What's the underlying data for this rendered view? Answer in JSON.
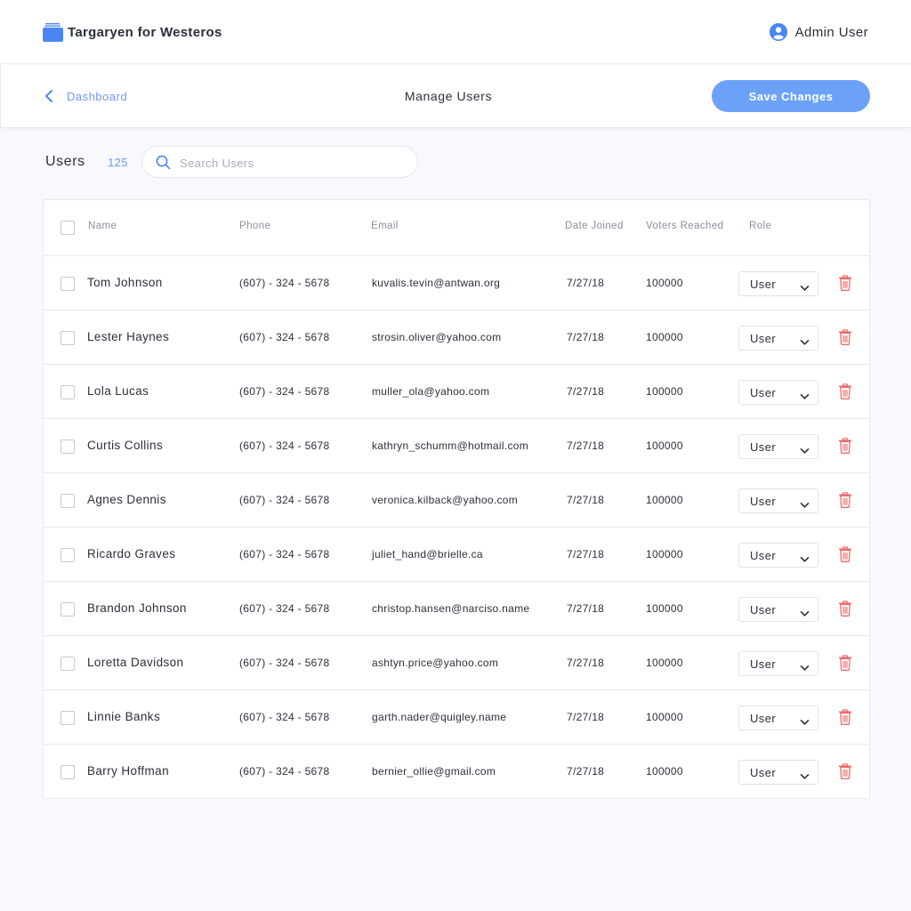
{
  "header": {
    "app_name": "Targaryen for Westeros",
    "user_name": "Admin User"
  },
  "subheader": {
    "back_label": "Dashboard",
    "title": "Manage Users",
    "save_label": "Save Changes"
  },
  "users_section": {
    "heading": "Users",
    "count": "125",
    "search_placeholder": "Search Users",
    "search_value": ""
  },
  "table": {
    "columns": {
      "name": "Name",
      "phone": "Phone",
      "email": "Email",
      "date_joined": "Date Joined",
      "voters_reached": "Voters Reached",
      "role": "Role"
    },
    "rows": [
      {
        "name": "Tom Johnson",
        "phone": "(607) - 324 - 5678",
        "email": "kuvalis.tevin@antwan.org",
        "date": "7/27/18",
        "voters": "100000",
        "role": "User"
      },
      {
        "name": "Lester Haynes",
        "phone": "(607) - 324 - 5678",
        "email": "strosin.oliver@yahoo.com",
        "date": "7/27/18",
        "voters": "100000",
        "role": "User"
      },
      {
        "name": "Lola Lucas",
        "phone": "(607) - 324 - 5678",
        "email": "muller_ola@yahoo.com",
        "date": "7/27/18",
        "voters": "100000",
        "role": "User"
      },
      {
        "name": "Curtis Collins",
        "phone": "(607) - 324 - 5678",
        "email": "kathryn_schumm@hotmail.com",
        "date": "7/27/18",
        "voters": "100000",
        "role": "User"
      },
      {
        "name": "Agnes Dennis",
        "phone": "(607) - 324 - 5678",
        "email": "veronica.kilback@yahoo.com",
        "date": "7/27/18",
        "voters": "100000",
        "role": "User"
      },
      {
        "name": "Ricardo Graves",
        "phone": "(607) - 324 - 5678",
        "email": "juliet_hand@brielle.ca",
        "date": "7/27/18",
        "voters": "100000",
        "role": "User"
      },
      {
        "name": "Brandon Johnson",
        "phone": "(607) - 324 - 5678",
        "email": "christop.hansen@narciso.name",
        "date": "7/27/18",
        "voters": "100000",
        "role": "User"
      },
      {
        "name": "Loretta Davidson",
        "phone": "(607) - 324 - 5678",
        "email": "ashtyn.price@yahoo.com",
        "date": "7/27/18",
        "voters": "100000",
        "role": "User"
      },
      {
        "name": "Linnie Banks",
        "phone": "(607) - 324 - 5678",
        "email": "garth.nader@quigley.name",
        "date": "7/27/18",
        "voters": "100000",
        "role": "User"
      },
      {
        "name": "Barry Hoffman",
        "phone": "(607) - 324 - 5678",
        "email": "bernier_ollie@gmail.com",
        "date": "7/27/18",
        "voters": "100000",
        "role": "User"
      }
    ]
  },
  "icons": {
    "brand": "folder-stack-icon",
    "avatar": "user-avatar-icon",
    "back": "chevron-left-icon",
    "search": "search-icon",
    "role_dropdown": "chevron-down-icon",
    "delete": "trash-icon"
  },
  "colors": {
    "accent": "#6ba2f8",
    "link": "#6f98f0",
    "danger": "#ec6b6b",
    "background": "#f8f9fc"
  }
}
